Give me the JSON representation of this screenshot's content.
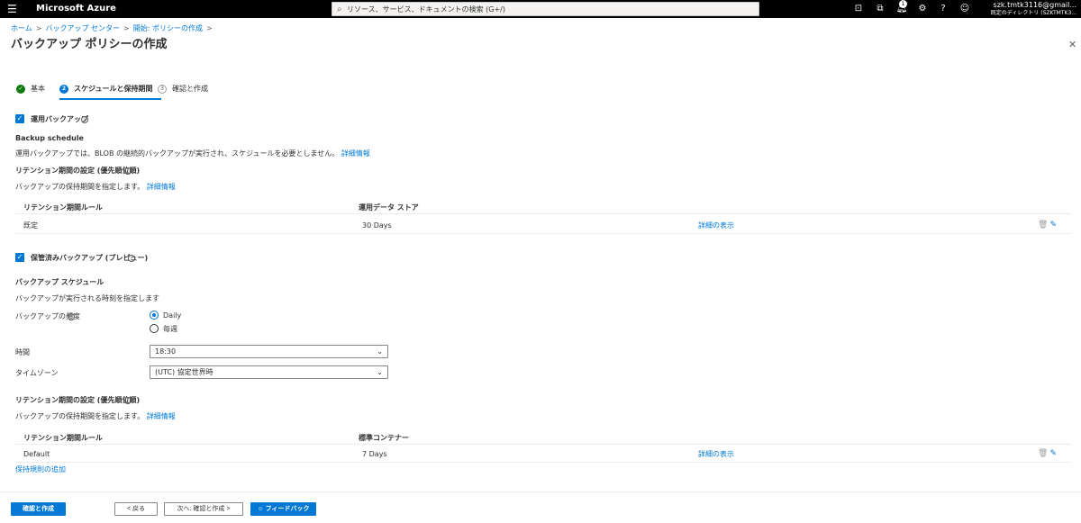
{
  "topbar": {
    "brand": "Microsoft Azure",
    "search_placeholder": "リソース、サービス、ドキュメントの検索 (G+/)",
    "notification_count": "1",
    "account_name": "szk.tmtk3116@gmail...",
    "account_directory": "既定のディレクトリ (SZKTMTK3..."
  },
  "breadcrumb": {
    "items": [
      "ホーム",
      "バックアップ センター",
      "開始: ポリシーの作成"
    ]
  },
  "page": {
    "title": "バックアップ ポリシーの作成",
    "more": "···"
  },
  "steps": [
    {
      "label": "基本",
      "state": "done",
      "num": "✓"
    },
    {
      "label": "スケジュールと保持期間",
      "state": "active",
      "num": "2"
    },
    {
      "label": "確認と作成",
      "state": "todo",
      "num": "3"
    }
  ],
  "operational": {
    "checkbox_label": "運用バックアップ",
    "schedule_heading": "Backup schedule",
    "schedule_desc": "運用バックアップでは、BLOB の継続的バックアップが実行され、スケジュールを必要としません。",
    "learn_more": "詳細情報",
    "retention_heading": "リテンション期間の設定 (優先順位順)",
    "retention_desc": "バックアップの保持期間を指定します。",
    "retention_learn_more": "詳細情報",
    "table": {
      "headers": [
        "リテンション期間ルール",
        "運用データ ストア"
      ],
      "rows": [
        {
          "rule": "既定",
          "store": "30 Days",
          "details": "詳細の表示"
        }
      ]
    }
  },
  "vaulted": {
    "checkbox_label": "保管済みバックアップ (プレビュー)",
    "schedule_heading": "バックアップ スケジュール",
    "schedule_desc": "バックアップが実行される時刻を指定します",
    "frequency_label": "バックアップの頻度",
    "frequency_options": [
      "Daily",
      "毎週"
    ],
    "frequency_selected": "Daily",
    "time_label": "時間",
    "time_value": "18:30",
    "timezone_label": "タイムゾーン",
    "timezone_value": "(UTC) 協定世界時",
    "retention_heading": "リテンション期間の設定 (優先順位順)",
    "retention_desc": "バックアップの保持期間を指定します。",
    "retention_learn_more": "詳細情報",
    "table": {
      "headers": [
        "リテンション期間ルール",
        "標準コンテナー"
      ],
      "rows": [
        {
          "rule": "Default",
          "store": "7 Days",
          "details": "詳細の表示"
        }
      ]
    },
    "add_rule": "保持規則の追加"
  },
  "footer": {
    "review_create": "確認と作成",
    "previous": "< 戻る",
    "next": "次へ: 確認と作成 >",
    "feedback": "フィードバック"
  },
  "colors": {
    "accent": "#0078d4",
    "success": "#107c10",
    "topbar": "#000000"
  }
}
